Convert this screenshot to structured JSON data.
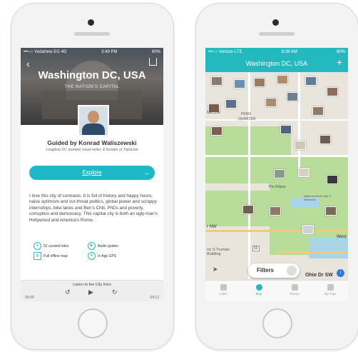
{
  "left_phone": {
    "status": {
      "carrier": "•••○○ Vodafone EG  4G",
      "time": "3:49 PM",
      "battery": "60%"
    },
    "hero": {
      "title": "Washington DC, USA",
      "subtitle": "THE NATION'S CAPITAL"
    },
    "guide": {
      "name": "Guided by Konrad Waliszewski",
      "bio": "Longtime DC resident, travel writer, & founder of TripScout"
    },
    "explore_label": "Explore",
    "description": "I love this city of contrasts. It is full of history and happy hours, naive optimism and cut-throat politics, global power and scrappy internships, bike lanes and Ben's Chili, PhDs and poverty, corruption and democracy. This capital city is both an ugly-man's Hollywood and America's Rome.",
    "features": [
      {
        "icon": "pin-icon",
        "label": "52 curated sites"
      },
      {
        "icon": "audio-icon",
        "label": "Audio guides"
      },
      {
        "icon": "map-icon",
        "label": "Full offline map"
      },
      {
        "icon": "gps-icon",
        "label": "In App GPS"
      }
    ],
    "player": {
      "title": "Listen to the City Intro",
      "elapsed": "00:00",
      "total": "04:12"
    }
  },
  "right_phone": {
    "status": {
      "carrier": "•••○○ Verizon  LTE",
      "time": "8:28 AM",
      "battery": "90%"
    },
    "title": "Washington DC, USA",
    "map_labels": [
      "NATION",
      "PENN",
      "QUARTER",
      "The Ellipse",
      "National World War II Memorial",
      "rry S Truman Building",
      "Ohio Dr SW",
      "West",
      "r NW",
      "50"
    ],
    "filters_label": "Filters",
    "tabs": [
      {
        "label": "Cities",
        "active": false
      },
      {
        "label": "Map",
        "active": true
      },
      {
        "label": "Places",
        "active": false
      },
      {
        "label": "My Trips",
        "active": false
      }
    ],
    "accent_color": "#23b9bf"
  }
}
